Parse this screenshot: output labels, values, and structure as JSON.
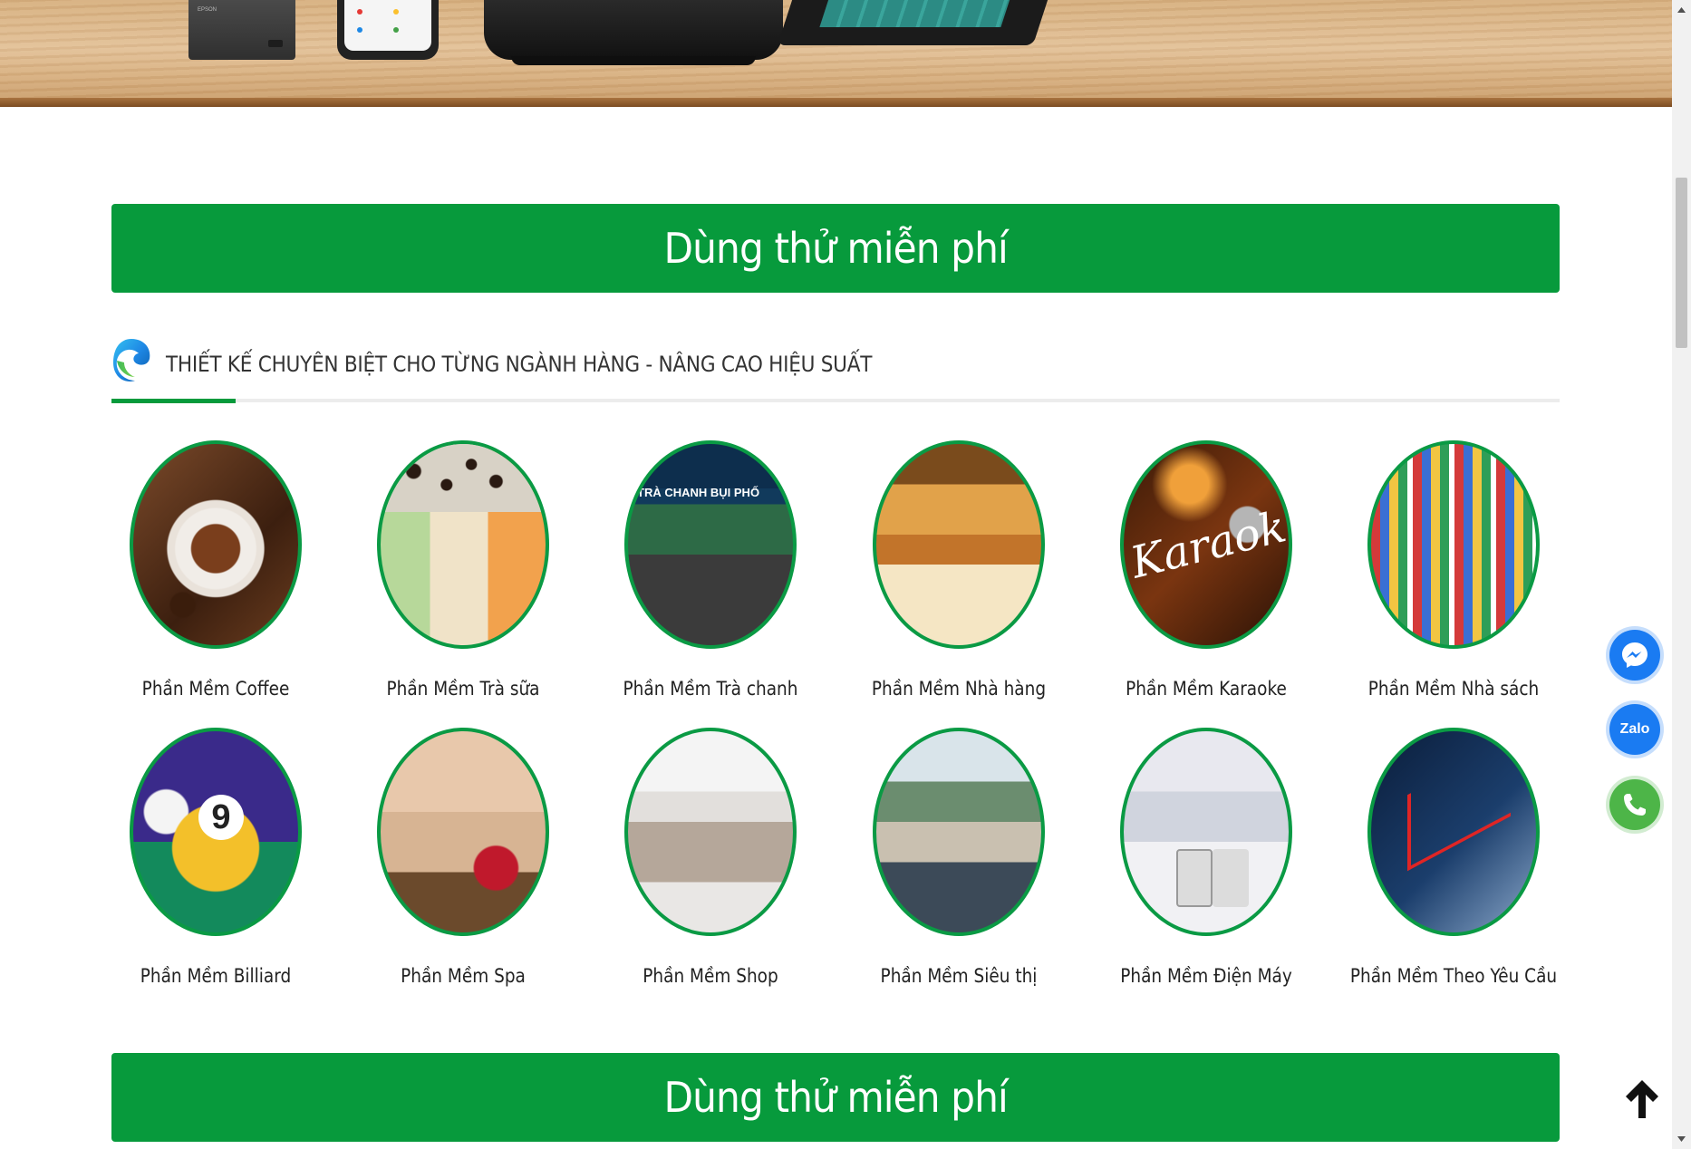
{
  "hero": {
    "printer_brand": "EPSON"
  },
  "cta_top": {
    "label": "Dùng thử miễn phí"
  },
  "cta_bottom": {
    "label": "Dùng thử miễn phí"
  },
  "section": {
    "title": "THIẾT KẾ CHUYÊN BIỆT CHO TỪNG NGÀNH HÀNG - NÂNG CAO HIỆU SUẤT",
    "logo_icon": "edge-logo-icon",
    "accent_color": "#079a3c"
  },
  "products": [
    {
      "label": "Phần Mềm Coffee",
      "icon": "coffee"
    },
    {
      "label": "Phần Mềm Trà sữa",
      "icon": "milk-tea"
    },
    {
      "label": "Phần Mềm Trà chanh",
      "icon": "lemon-tea"
    },
    {
      "label": "Phần Mềm Nhà hàng",
      "icon": "restaurant"
    },
    {
      "label": "Phần Mềm Karaoke",
      "icon": "karaoke"
    },
    {
      "label": "Phần Mềm Nhà sách",
      "icon": "bookstore"
    },
    {
      "label": "Phần Mềm Billiard",
      "icon": "billiard"
    },
    {
      "label": "Phần Mềm Spa",
      "icon": "spa"
    },
    {
      "label": "Phần Mềm Shop",
      "icon": "shop"
    },
    {
      "label": "Phần Mềm Siêu thị",
      "icon": "supermarket"
    },
    {
      "label": "Phần Mềm Điện Máy",
      "icon": "electronics"
    },
    {
      "label": "Phần Mềm Theo Yêu Cầu",
      "icon": "custom"
    }
  ],
  "floating": {
    "zalo_label": "Zalo",
    "messenger_icon": "messenger-icon",
    "phone_icon": "phone-icon",
    "back_to_top_icon": "arrow-up-icon"
  },
  "colors": {
    "brand_green": "#079a3c",
    "messenger_blue": "#1a7bf2",
    "phone_green": "#4db548"
  }
}
